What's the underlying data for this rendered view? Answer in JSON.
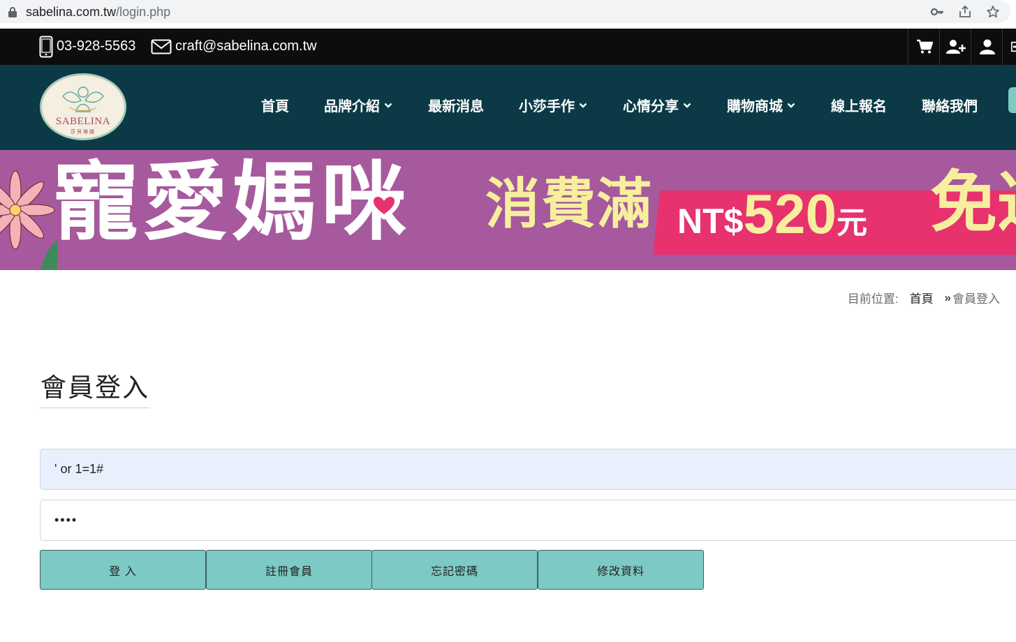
{
  "browser": {
    "url_domain": "sabelina.com.tw",
    "url_path": "/login.php",
    "icons": [
      "lock-icon",
      "key-icon",
      "share-icon",
      "star-icon"
    ]
  },
  "topbar": {
    "phone": "03-928-5563",
    "email": "craft@sabelina.com.tw",
    "icons": [
      "mobile-phone-icon",
      "envelope-icon",
      "cart-icon",
      "add-user-icon",
      "user-icon",
      "signin-icon"
    ]
  },
  "logo": {
    "text": "SABELINA",
    "subtext": "莎貝琳娜"
  },
  "nav": {
    "items": [
      {
        "label": "首頁",
        "dropdown": false
      },
      {
        "label": "品牌介紹",
        "dropdown": true
      },
      {
        "label": "最新消息",
        "dropdown": false
      },
      {
        "label": "小莎手作",
        "dropdown": true
      },
      {
        "label": "心情分享",
        "dropdown": true
      },
      {
        "label": "購物商城",
        "dropdown": true
      },
      {
        "label": "線上報名",
        "dropdown": false
      },
      {
        "label": "聯絡我們",
        "dropdown": false
      }
    ]
  },
  "banner": {
    "headline": "寵愛媽咪",
    "condition": "消費滿",
    "currency": "NT$",
    "amount": "520",
    "unit": "元",
    "offer": "免運"
  },
  "breadcrumb": {
    "prefix": "目前位置:",
    "home": "首頁",
    "current": "會員登入"
  },
  "page": {
    "title": "會員登入"
  },
  "form": {
    "account_value": "' or 1=1#",
    "password_value": "••••"
  },
  "buttons": {
    "login": "登 入",
    "register": "註冊會員",
    "forgot": "忘記密碼",
    "edit": "修改資料"
  },
  "colors": {
    "topbar": "#0d0d0d",
    "navbar": "#0b3a46",
    "banner": "#a6599d",
    "banner_accent": "#e7326e",
    "button": "#7dc9c5",
    "autofill": "#e8f0fe"
  }
}
